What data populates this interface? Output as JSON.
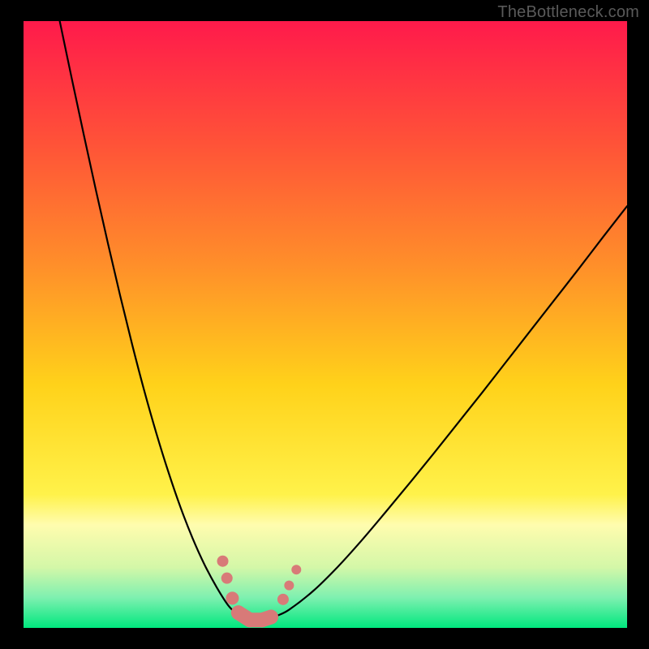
{
  "watermark": "TheBottleneck.com",
  "chart_data": {
    "type": "line",
    "title": "",
    "xlabel": "",
    "ylabel": "",
    "xlim": [
      0,
      100
    ],
    "ylim": [
      0,
      100
    ],
    "gradient_stops": [
      {
        "offset": 0.0,
        "color": "#ff1a4b"
      },
      {
        "offset": 0.2,
        "color": "#ff5238"
      },
      {
        "offset": 0.4,
        "color": "#ff8e2a"
      },
      {
        "offset": 0.6,
        "color": "#ffd21a"
      },
      {
        "offset": 0.78,
        "color": "#fff24a"
      },
      {
        "offset": 0.83,
        "color": "#fffcae"
      },
      {
        "offset": 0.9,
        "color": "#d4f7a8"
      },
      {
        "offset": 0.95,
        "color": "#7ef0b0"
      },
      {
        "offset": 1.0,
        "color": "#00e77e"
      }
    ],
    "series": [
      {
        "name": "left-curve",
        "x": [
          6,
          8,
          10,
          12,
          14,
          16,
          18,
          20,
          22,
          24,
          26,
          28,
          30,
          32,
          34,
          35.5
        ],
        "y": [
          100,
          90.5,
          81.2,
          72.1,
          63.3,
          54.8,
          46.7,
          39.1,
          32.1,
          25.7,
          19.9,
          14.8,
          10.4,
          6.7,
          3.6,
          2.2
        ]
      },
      {
        "name": "right-curve",
        "x": [
          42,
          44,
          48,
          52,
          56,
          60,
          64,
          68,
          72,
          76,
          80,
          84,
          88,
          92,
          96,
          100
        ],
        "y": [
          2.0,
          3.0,
          6.1,
          10.0,
          14.4,
          19.1,
          23.9,
          28.8,
          33.8,
          38.8,
          43.9,
          49.0,
          54.1,
          59.2,
          64.4,
          69.5
        ]
      }
    ],
    "markers": {
      "name": "data-band",
      "color": "#d87a78",
      "points": [
        {
          "x": 33.0,
          "y": 11.0,
          "r": 7
        },
        {
          "x": 33.7,
          "y": 8.2,
          "r": 7
        },
        {
          "x": 34.6,
          "y": 4.9,
          "r": 8
        },
        {
          "x": 35.6,
          "y": 2.5,
          "r": 9
        },
        {
          "x": 37.5,
          "y": 1.3,
          "r": 9
        },
        {
          "x": 39.5,
          "y": 1.3,
          "r": 9
        },
        {
          "x": 41.0,
          "y": 1.8,
          "r": 8
        },
        {
          "x": 43.0,
          "y": 4.7,
          "r": 7
        },
        {
          "x": 44.0,
          "y": 7.0,
          "r": 6
        },
        {
          "x": 45.2,
          "y": 9.6,
          "r": 6
        }
      ]
    }
  }
}
